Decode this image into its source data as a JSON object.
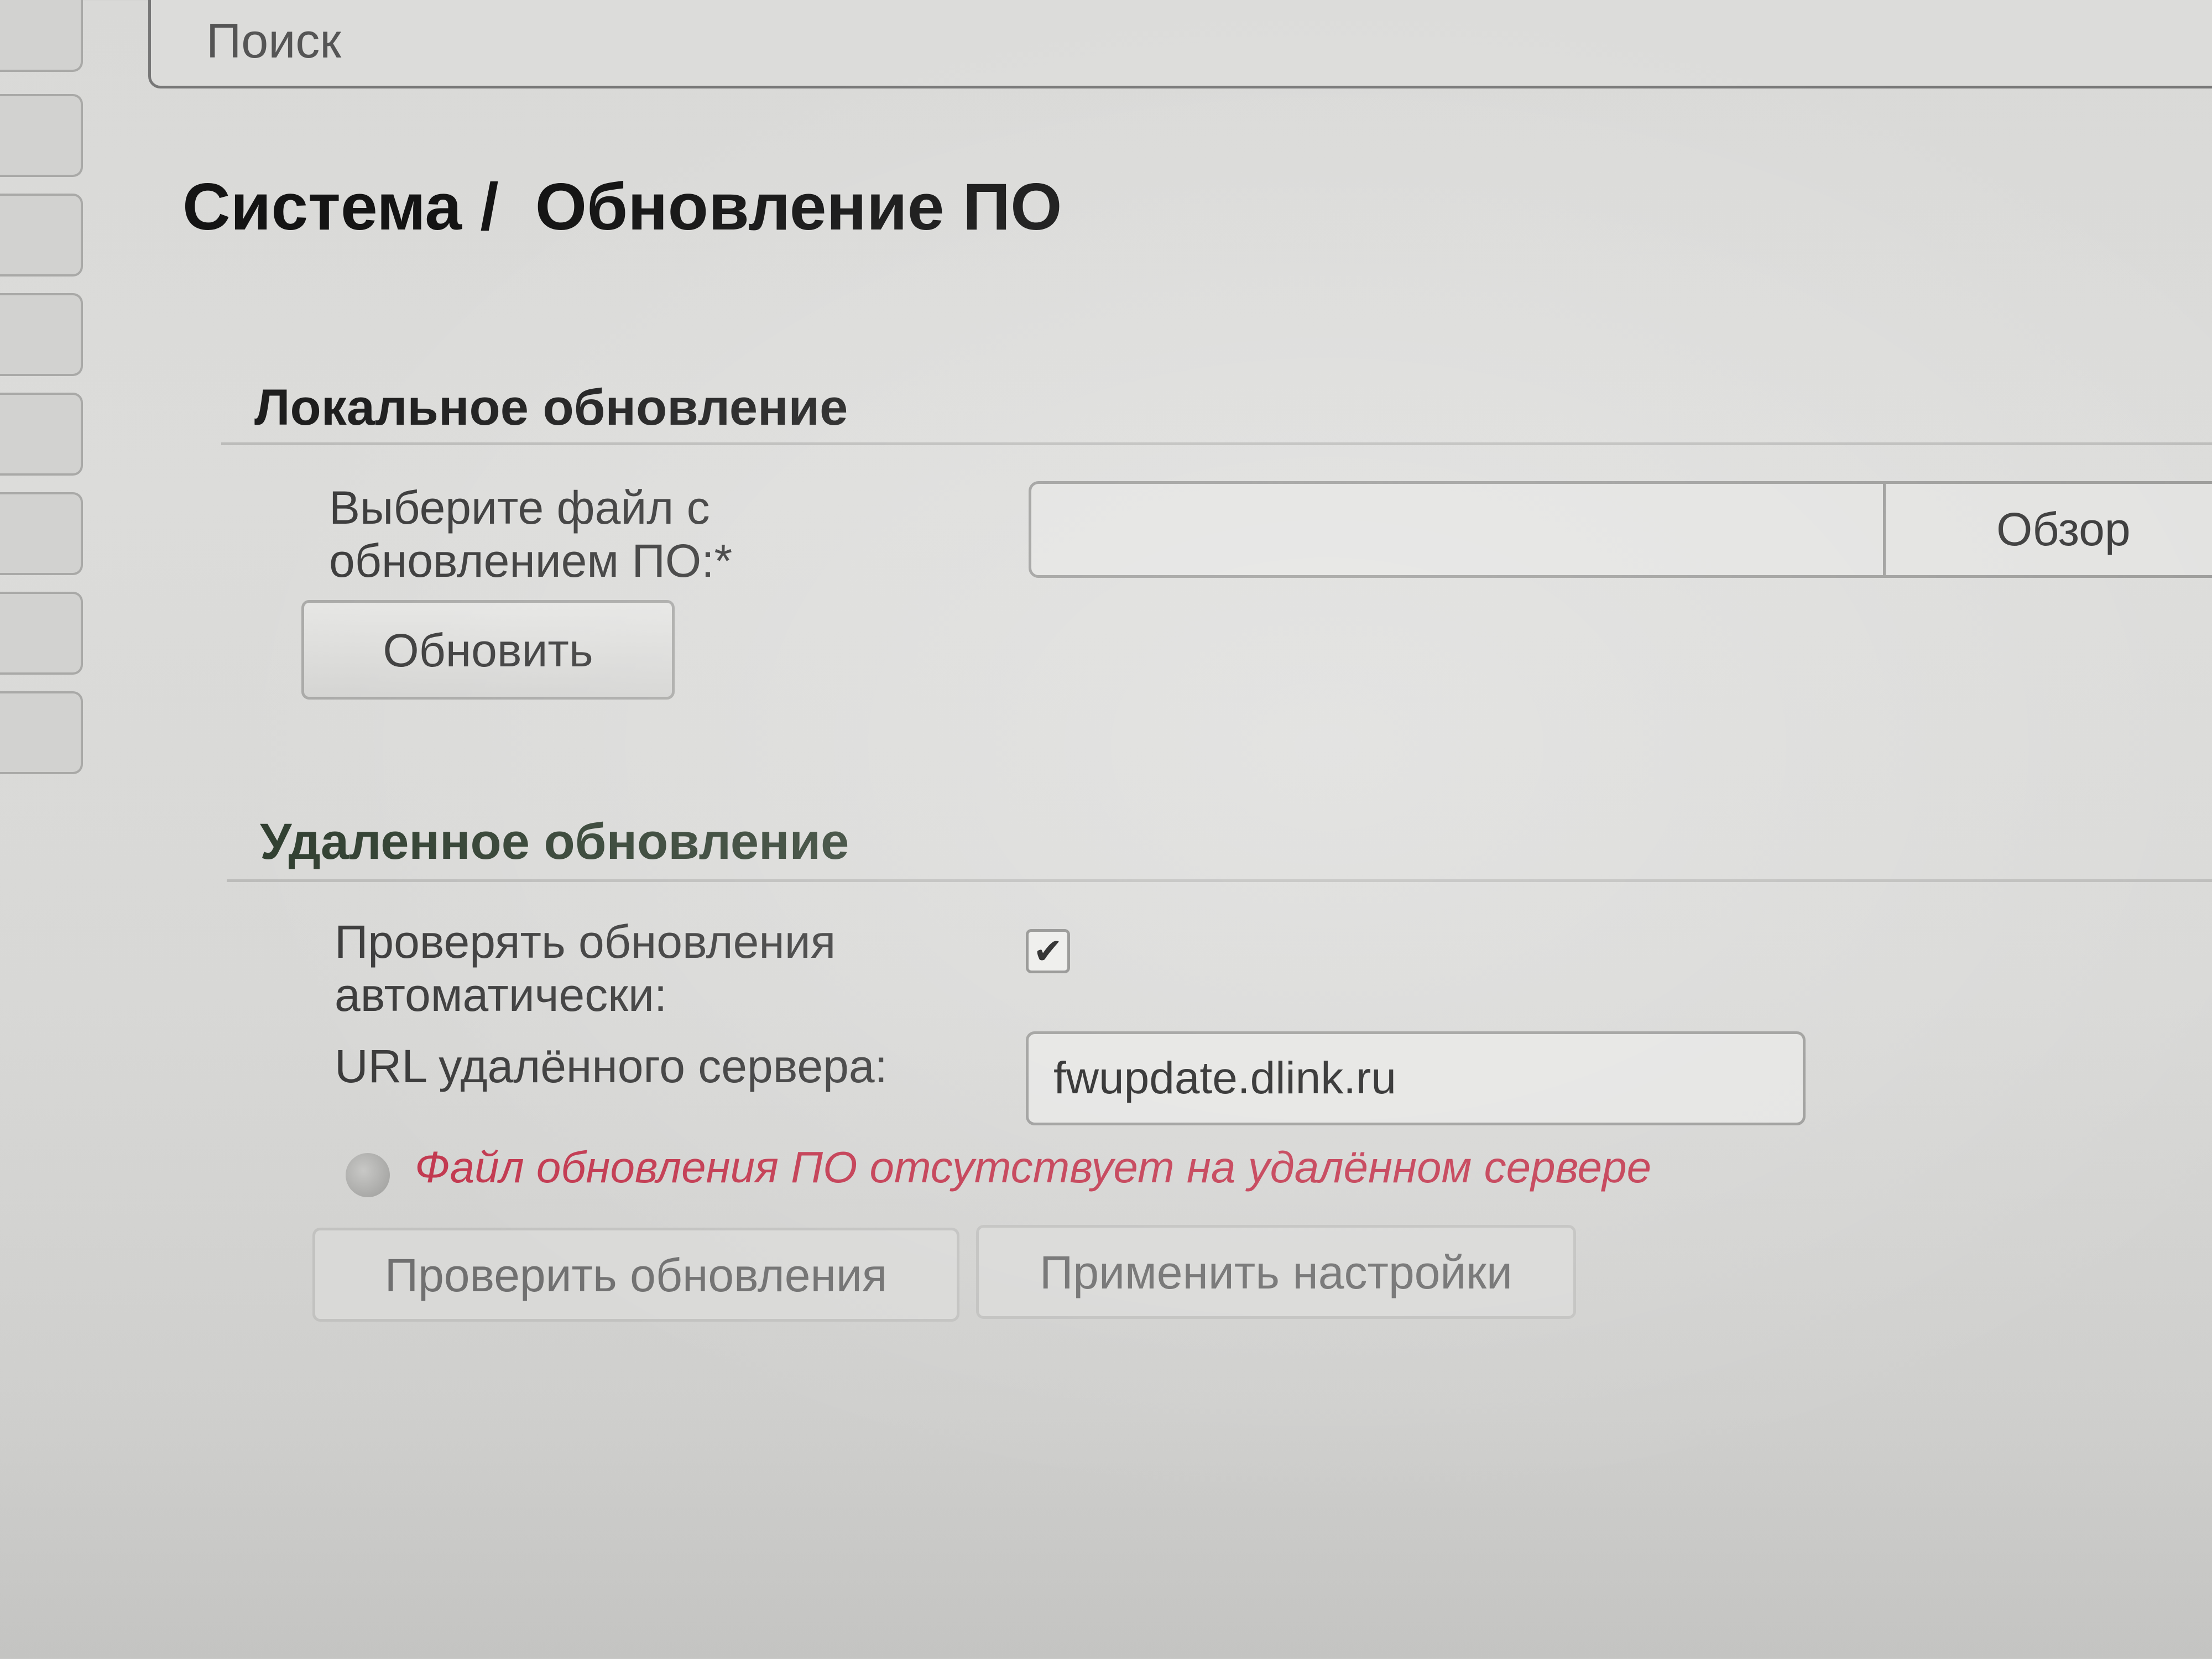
{
  "search": {
    "label": "Поиск"
  },
  "page": {
    "breadcrumb_root": "Система /",
    "title": "Обновление ПО"
  },
  "local_update": {
    "section_title": "Локальное обновление",
    "file_label_line1": "Выберите файл с",
    "file_label_line2": "обновлением ПО:*",
    "file_value": "",
    "browse_label": "Обзор",
    "update_button": "Обновить"
  },
  "remote_update": {
    "section_title": "Удаленное обновление",
    "auto_check_label_line1": "Проверять обновления",
    "auto_check_label_line2": "автоматически:",
    "auto_check_checked": true,
    "checkmark": "✔",
    "server_url_label": "URL удалённого сервера:",
    "server_url_value": "fwupdate.dlink.ru",
    "status_message": "Файл обновления ПО отсутствует на удалённом сервере",
    "status_color": "#c2384f",
    "check_button": "Проверить обновления",
    "apply_button": "Применить настройки"
  },
  "sidebar": {
    "tab_count": 8
  }
}
